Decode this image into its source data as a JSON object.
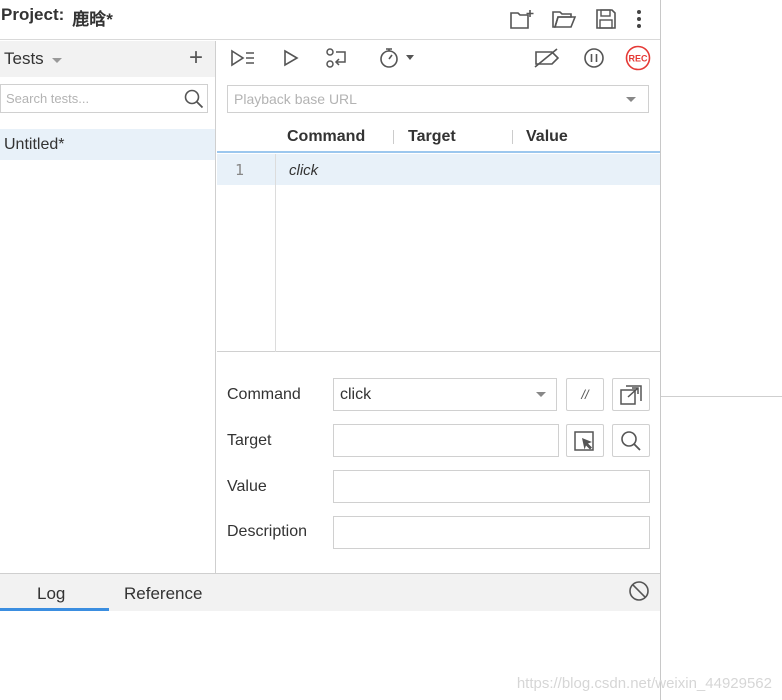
{
  "header": {
    "project_label": "Project:",
    "project_name": "鹿晗*",
    "icons": [
      "new-project-icon",
      "open-folder-icon",
      "save-icon",
      "more-vert-icon"
    ]
  },
  "tests_panel": {
    "title": "Tests",
    "add_symbol": "+",
    "search_placeholder": "Search tests...",
    "items": [
      {
        "label": "Untitled*",
        "selected": true
      }
    ]
  },
  "toolbar": {
    "icons": [
      "run-all-icon",
      "run-current-icon",
      "step-over-icon",
      "speed-icon",
      "disable-breakpoints-icon",
      "pause-on-exception-icon",
      "record-icon"
    ],
    "record_text": "REC"
  },
  "url_bar": {
    "placeholder": "Playback base URL",
    "value": ""
  },
  "commands_table": {
    "columns": [
      "Command",
      "Target",
      "Value"
    ],
    "rows": [
      {
        "num": "1",
        "command": "click",
        "target": "",
        "value": ""
      }
    ]
  },
  "editor": {
    "command_label": "Command",
    "command_value": "click",
    "target_label": "Target",
    "target_value": "",
    "value_label": "Value",
    "value_value": "",
    "description_label": "Description",
    "description_value": "",
    "comment_button": "//"
  },
  "bottom_panel": {
    "tabs": [
      {
        "label": "Log",
        "active": true
      },
      {
        "label": "Reference",
        "active": false
      }
    ]
  },
  "watermark": "https://blog.csdn.net/weixin_44929562",
  "colors": {
    "accent": "#3b8ee0",
    "selected_row": "#e8f1f9",
    "record_red": "#e53935"
  }
}
